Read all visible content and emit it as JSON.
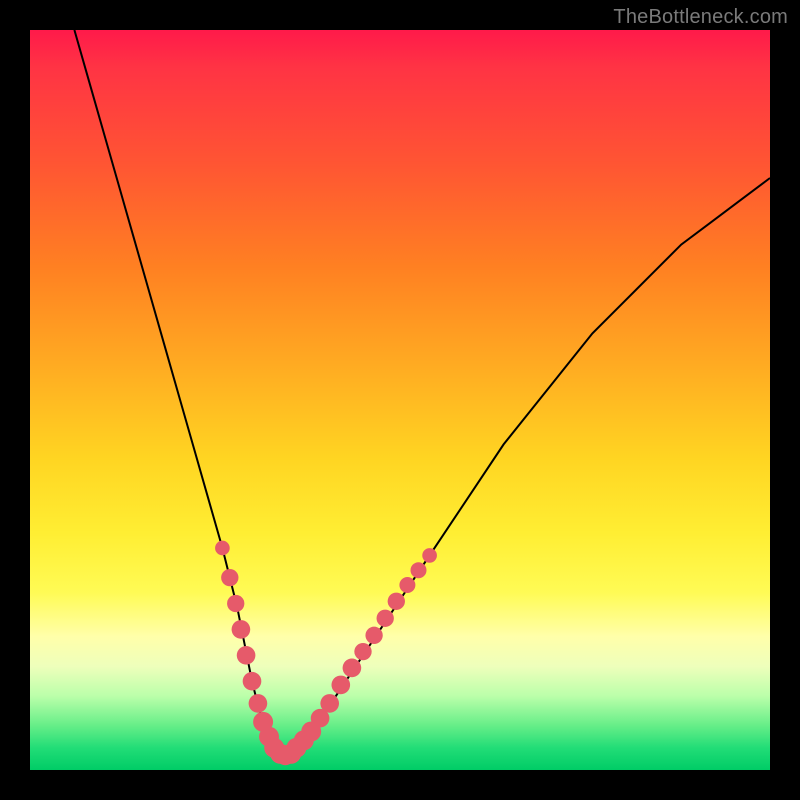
{
  "watermark": "TheBottleneck.com",
  "chart_data": {
    "type": "line",
    "title": "",
    "xlabel": "",
    "ylabel": "",
    "xlim": [
      0,
      100
    ],
    "ylim": [
      0,
      100
    ],
    "grid": false,
    "legend": false,
    "series": [
      {
        "name": "curve",
        "stroke": "#000000",
        "x": [
          6,
          8,
          10,
          12,
          14,
          16,
          18,
          20,
          22,
          24,
          26,
          28,
          29,
          30,
          31,
          32,
          33,
          34,
          35,
          36,
          38,
          40,
          44,
          48,
          52,
          56,
          60,
          64,
          68,
          72,
          76,
          80,
          84,
          88,
          92,
          96,
          100
        ],
        "y": [
          100,
          93,
          86,
          79,
          72,
          65,
          58,
          51,
          44,
          37,
          30,
          22,
          17,
          12,
          8,
          5,
          3,
          2,
          2,
          3,
          5,
          8,
          14,
          20,
          26,
          32,
          38,
          44,
          49,
          54,
          59,
          63,
          67,
          71,
          74,
          77,
          80
        ]
      }
    ],
    "markers": {
      "name": "dots",
      "fill": "#e65a6a",
      "points": [
        {
          "x": 26.0,
          "y": 30.0,
          "r": 1.1
        },
        {
          "x": 27.0,
          "y": 26.0,
          "r": 1.3
        },
        {
          "x": 27.8,
          "y": 22.5,
          "r": 1.3
        },
        {
          "x": 28.5,
          "y": 19.0,
          "r": 1.4
        },
        {
          "x": 29.2,
          "y": 15.5,
          "r": 1.4
        },
        {
          "x": 30.0,
          "y": 12.0,
          "r": 1.4
        },
        {
          "x": 30.8,
          "y": 9.0,
          "r": 1.4
        },
        {
          "x": 31.5,
          "y": 6.5,
          "r": 1.5
        },
        {
          "x": 32.3,
          "y": 4.5,
          "r": 1.5
        },
        {
          "x": 33.0,
          "y": 3.0,
          "r": 1.5
        },
        {
          "x": 33.8,
          "y": 2.2,
          "r": 1.5
        },
        {
          "x": 34.5,
          "y": 2.0,
          "r": 1.5
        },
        {
          "x": 35.3,
          "y": 2.2,
          "r": 1.5
        },
        {
          "x": 36.0,
          "y": 3.0,
          "r": 1.5
        },
        {
          "x": 37.0,
          "y": 4.0,
          "r": 1.5
        },
        {
          "x": 38.0,
          "y": 5.2,
          "r": 1.5
        },
        {
          "x": 39.2,
          "y": 7.0,
          "r": 1.4
        },
        {
          "x": 40.5,
          "y": 9.0,
          "r": 1.4
        },
        {
          "x": 42.0,
          "y": 11.5,
          "r": 1.4
        },
        {
          "x": 43.5,
          "y": 13.8,
          "r": 1.4
        },
        {
          "x": 45.0,
          "y": 16.0,
          "r": 1.3
        },
        {
          "x": 46.5,
          "y": 18.2,
          "r": 1.3
        },
        {
          "x": 48.0,
          "y": 20.5,
          "r": 1.3
        },
        {
          "x": 49.5,
          "y": 22.8,
          "r": 1.3
        },
        {
          "x": 51.0,
          "y": 25.0,
          "r": 1.2
        },
        {
          "x": 52.5,
          "y": 27.0,
          "r": 1.2
        },
        {
          "x": 54.0,
          "y": 29.0,
          "r": 1.1
        }
      ]
    }
  }
}
